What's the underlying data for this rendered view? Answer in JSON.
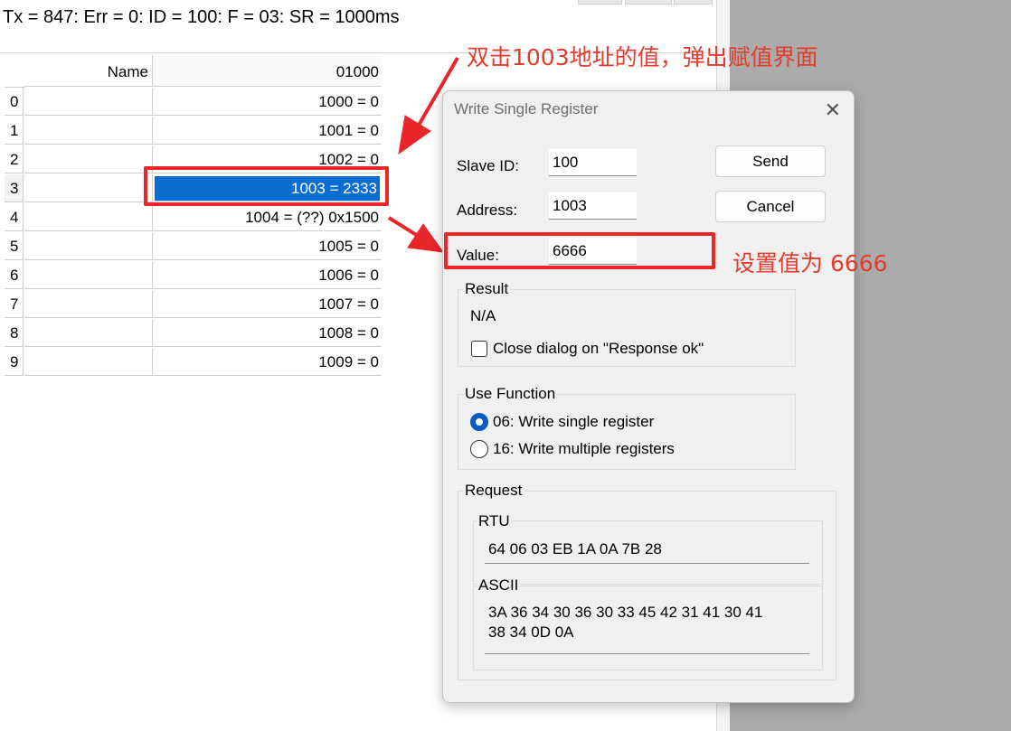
{
  "status": {
    "text": "Tx = 847: Err = 0: ID = 100: F = 03: SR = 1000ms"
  },
  "grid": {
    "name_header": "Name",
    "value_header": "01000",
    "rows": [
      {
        "index": "0",
        "value": "1000 = 0"
      },
      {
        "index": "1",
        "value": "1001 = 0"
      },
      {
        "index": "2",
        "value": "1002 = 0"
      },
      {
        "index": "3",
        "value": "1003 = 2333"
      },
      {
        "index": "4",
        "value": "1004 = (??) 0x1500"
      },
      {
        "index": "5",
        "value": "1005 = 0"
      },
      {
        "index": "6",
        "value": "1006 = 0"
      },
      {
        "index": "7",
        "value": "1007 = 0"
      },
      {
        "index": "8",
        "value": "1008 = 0"
      },
      {
        "index": "9",
        "value": "1009 = 0"
      }
    ],
    "selected_row": "3"
  },
  "annotations": {
    "top_note": "双击1003地址的值，弹出赋值界面",
    "value_note": "设置值为 6666",
    "color": "#e9262a"
  },
  "dialog": {
    "title": "Write Single Register",
    "slave_id_label": "Slave ID:",
    "slave_id_value": "100",
    "address_label": "Address:",
    "address_value": "1003",
    "value_label": "Value:",
    "value_value": "6666",
    "send_label": "Send",
    "cancel_label": "Cancel",
    "result": {
      "title": "Result",
      "text": "N/A",
      "close_checkbox_label": "Close dialog on \"Response ok\"",
      "close_checked": false
    },
    "use_function": {
      "title": "Use Function",
      "options": [
        {
          "label": "06: Write single register",
          "selected": true
        },
        {
          "label": "16: Write multiple registers",
          "selected": false
        }
      ]
    },
    "request": {
      "title": "Request",
      "rtu_title": "RTU",
      "rtu_value": "64 06 03 EB 1A 0A 7B 28",
      "ascii_title": "ASCII",
      "ascii_line1": "3A 36 34 30 36 30 33 45 42 31 41 30 41",
      "ascii_line2": "38 34 0D 0A"
    }
  },
  "colors": {
    "selection": "#0a6ed1",
    "radio_on": "#0a5cbf",
    "annotation": "#e9262a"
  }
}
